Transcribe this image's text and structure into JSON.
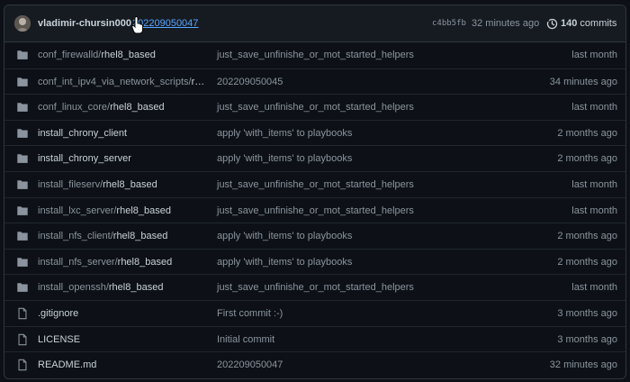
{
  "header": {
    "author": "vladimir-chursin000",
    "commit_message": "202209050047",
    "sha": "c4bb5fb",
    "time": "32 minutes ago",
    "commits_count": "140",
    "commits_label": "commits"
  },
  "files": [
    {
      "type": "folder",
      "name_prefix": "conf_firewalld/",
      "name_main": "rhel8_based",
      "message": "just_save_unfinishe_or_mot_started_helpers",
      "age": "last month"
    },
    {
      "type": "folder",
      "name_prefix": "conf_int_ipv4_via_network_scripts/",
      "name_main": "rhe…",
      "message": "202209050045",
      "age": "34 minutes ago"
    },
    {
      "type": "folder",
      "name_prefix": "conf_linux_core/",
      "name_main": "rhel8_based",
      "message": "just_save_unfinishe_or_mot_started_helpers",
      "age": "last month"
    },
    {
      "type": "folder",
      "name_prefix": "",
      "name_main": "install_chrony_client",
      "message": "apply 'with_items' to playbooks",
      "age": "2 months ago"
    },
    {
      "type": "folder",
      "name_prefix": "",
      "name_main": "install_chrony_server",
      "message": "apply 'with_items' to playbooks",
      "age": "2 months ago"
    },
    {
      "type": "folder",
      "name_prefix": "install_fileserv/",
      "name_main": "rhel8_based",
      "message": "just_save_unfinishe_or_mot_started_helpers",
      "age": "last month"
    },
    {
      "type": "folder",
      "name_prefix": "install_lxc_server/",
      "name_main": "rhel8_based",
      "message": "just_save_unfinishe_or_mot_started_helpers",
      "age": "last month"
    },
    {
      "type": "folder",
      "name_prefix": "install_nfs_client/",
      "name_main": "rhel8_based",
      "message": "apply 'with_items' to playbooks",
      "age": "2 months ago"
    },
    {
      "type": "folder",
      "name_prefix": "install_nfs_server/",
      "name_main": "rhel8_based",
      "message": "apply 'with_items' to playbooks",
      "age": "2 months ago"
    },
    {
      "type": "folder",
      "name_prefix": "install_openssh/",
      "name_main": "rhel8_based",
      "message": "just_save_unfinishe_or_mot_started_helpers",
      "age": "last month"
    },
    {
      "type": "file",
      "name_prefix": "",
      "name_main": ".gitignore",
      "message": "First commit :-)",
      "age": "3 months ago"
    },
    {
      "type": "file",
      "name_prefix": "",
      "name_main": "LICENSE",
      "message": "Initial commit",
      "age": "3 months ago"
    },
    {
      "type": "file",
      "name_prefix": "",
      "name_main": "README.md",
      "message": "202209050047",
      "age": "32 minutes ago"
    }
  ]
}
